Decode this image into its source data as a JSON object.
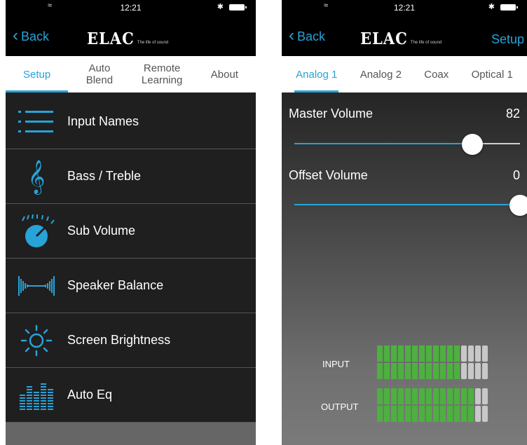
{
  "status_bar": {
    "time": "12:21"
  },
  "left": {
    "nav": {
      "back_label": "Back",
      "brand": "ELAC",
      "tagline": "The life of sound"
    },
    "tabs": [
      {
        "label": "Setup",
        "active": true
      },
      {
        "label": "Auto Blend",
        "active": false
      },
      {
        "label": "Remote Learning",
        "active": false
      },
      {
        "label": "About",
        "active": false
      }
    ],
    "menu": [
      {
        "label": "Input Names",
        "icon": "list-icon"
      },
      {
        "label": "Bass / Treble",
        "icon": "treble-clef-icon"
      },
      {
        "label": "Sub Volume",
        "icon": "volume-knob-icon"
      },
      {
        "label": "Speaker Balance",
        "icon": "waveform-icon"
      },
      {
        "label": "Screen Brightness",
        "icon": "sun-icon"
      },
      {
        "label": "Auto Eq",
        "icon": "equalizer-icon"
      }
    ]
  },
  "right": {
    "nav": {
      "back_label": "Back",
      "brand": "ELAC",
      "tagline": "The life of sound",
      "setup_label": "Setup"
    },
    "tabs": [
      {
        "label": "Analog 1",
        "active": true
      },
      {
        "label": "Analog 2",
        "active": false
      },
      {
        "label": "Coax",
        "active": false
      },
      {
        "label": "Optical 1",
        "active": false
      }
    ],
    "master_volume": {
      "label": "Master Volume",
      "value": "82",
      "fraction": 0.79
    },
    "offset_volume": {
      "label": "Offset Volume",
      "value": "0",
      "fraction": 1.0
    },
    "meters": {
      "input_label": "INPUT",
      "output_label": "OUTPUT",
      "input_green_segments": 12,
      "output_green_segments": 14,
      "total_segments": 16
    }
  },
  "colors": {
    "accent": "#27a3d8",
    "meter_green": "#4cb13e",
    "list_bg": "#1f1f1f"
  }
}
